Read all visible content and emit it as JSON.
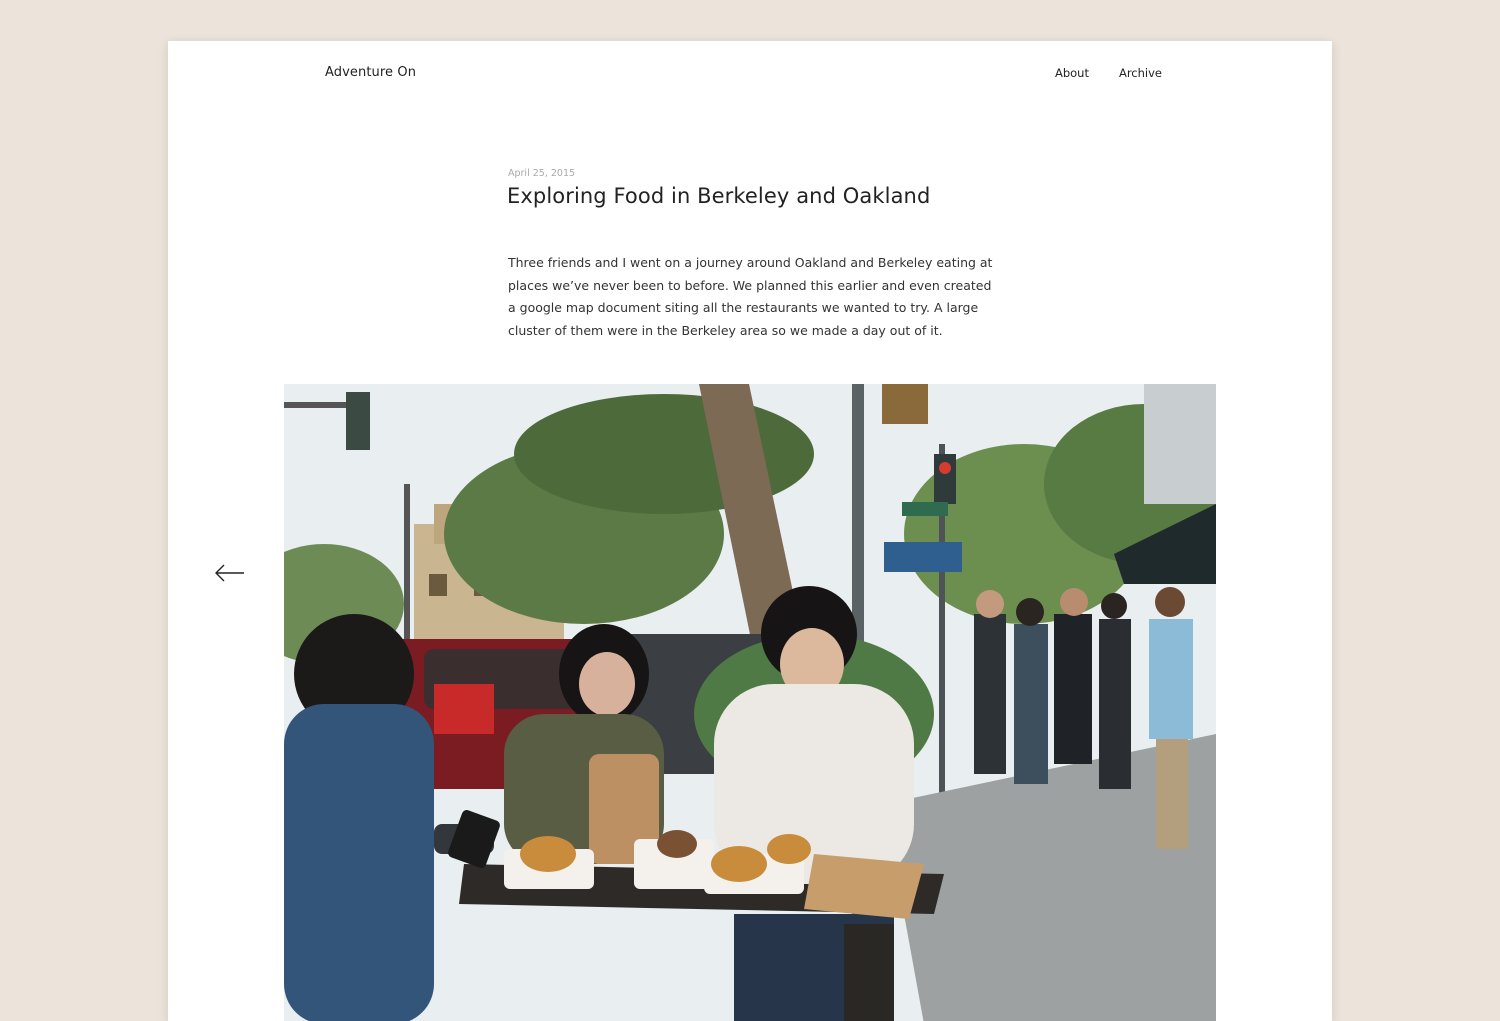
{
  "header": {
    "site_title": "Adventure On",
    "nav": [
      {
        "label": "About"
      },
      {
        "label": "Archive"
      }
    ]
  },
  "post": {
    "date": "April 25, 2015",
    "title": "Exploring Food in Berkeley and Oakland",
    "body": "Three friends and I went on a journey around Oakland and Berkeley eating at places we’ve never been to before. We planned this earlier and even created a google map document siting all the restaurants we wanted to try. A large cluster of them were in the Berkeley area so we made a day out of it."
  },
  "gallery": {
    "prev_icon": "arrow-left-icon",
    "photo_subject": "photo"
  },
  "colors": {
    "background": "#ece4db",
    "card": "#ffffff",
    "text": "#222222",
    "muted": "#a9a9a9"
  }
}
